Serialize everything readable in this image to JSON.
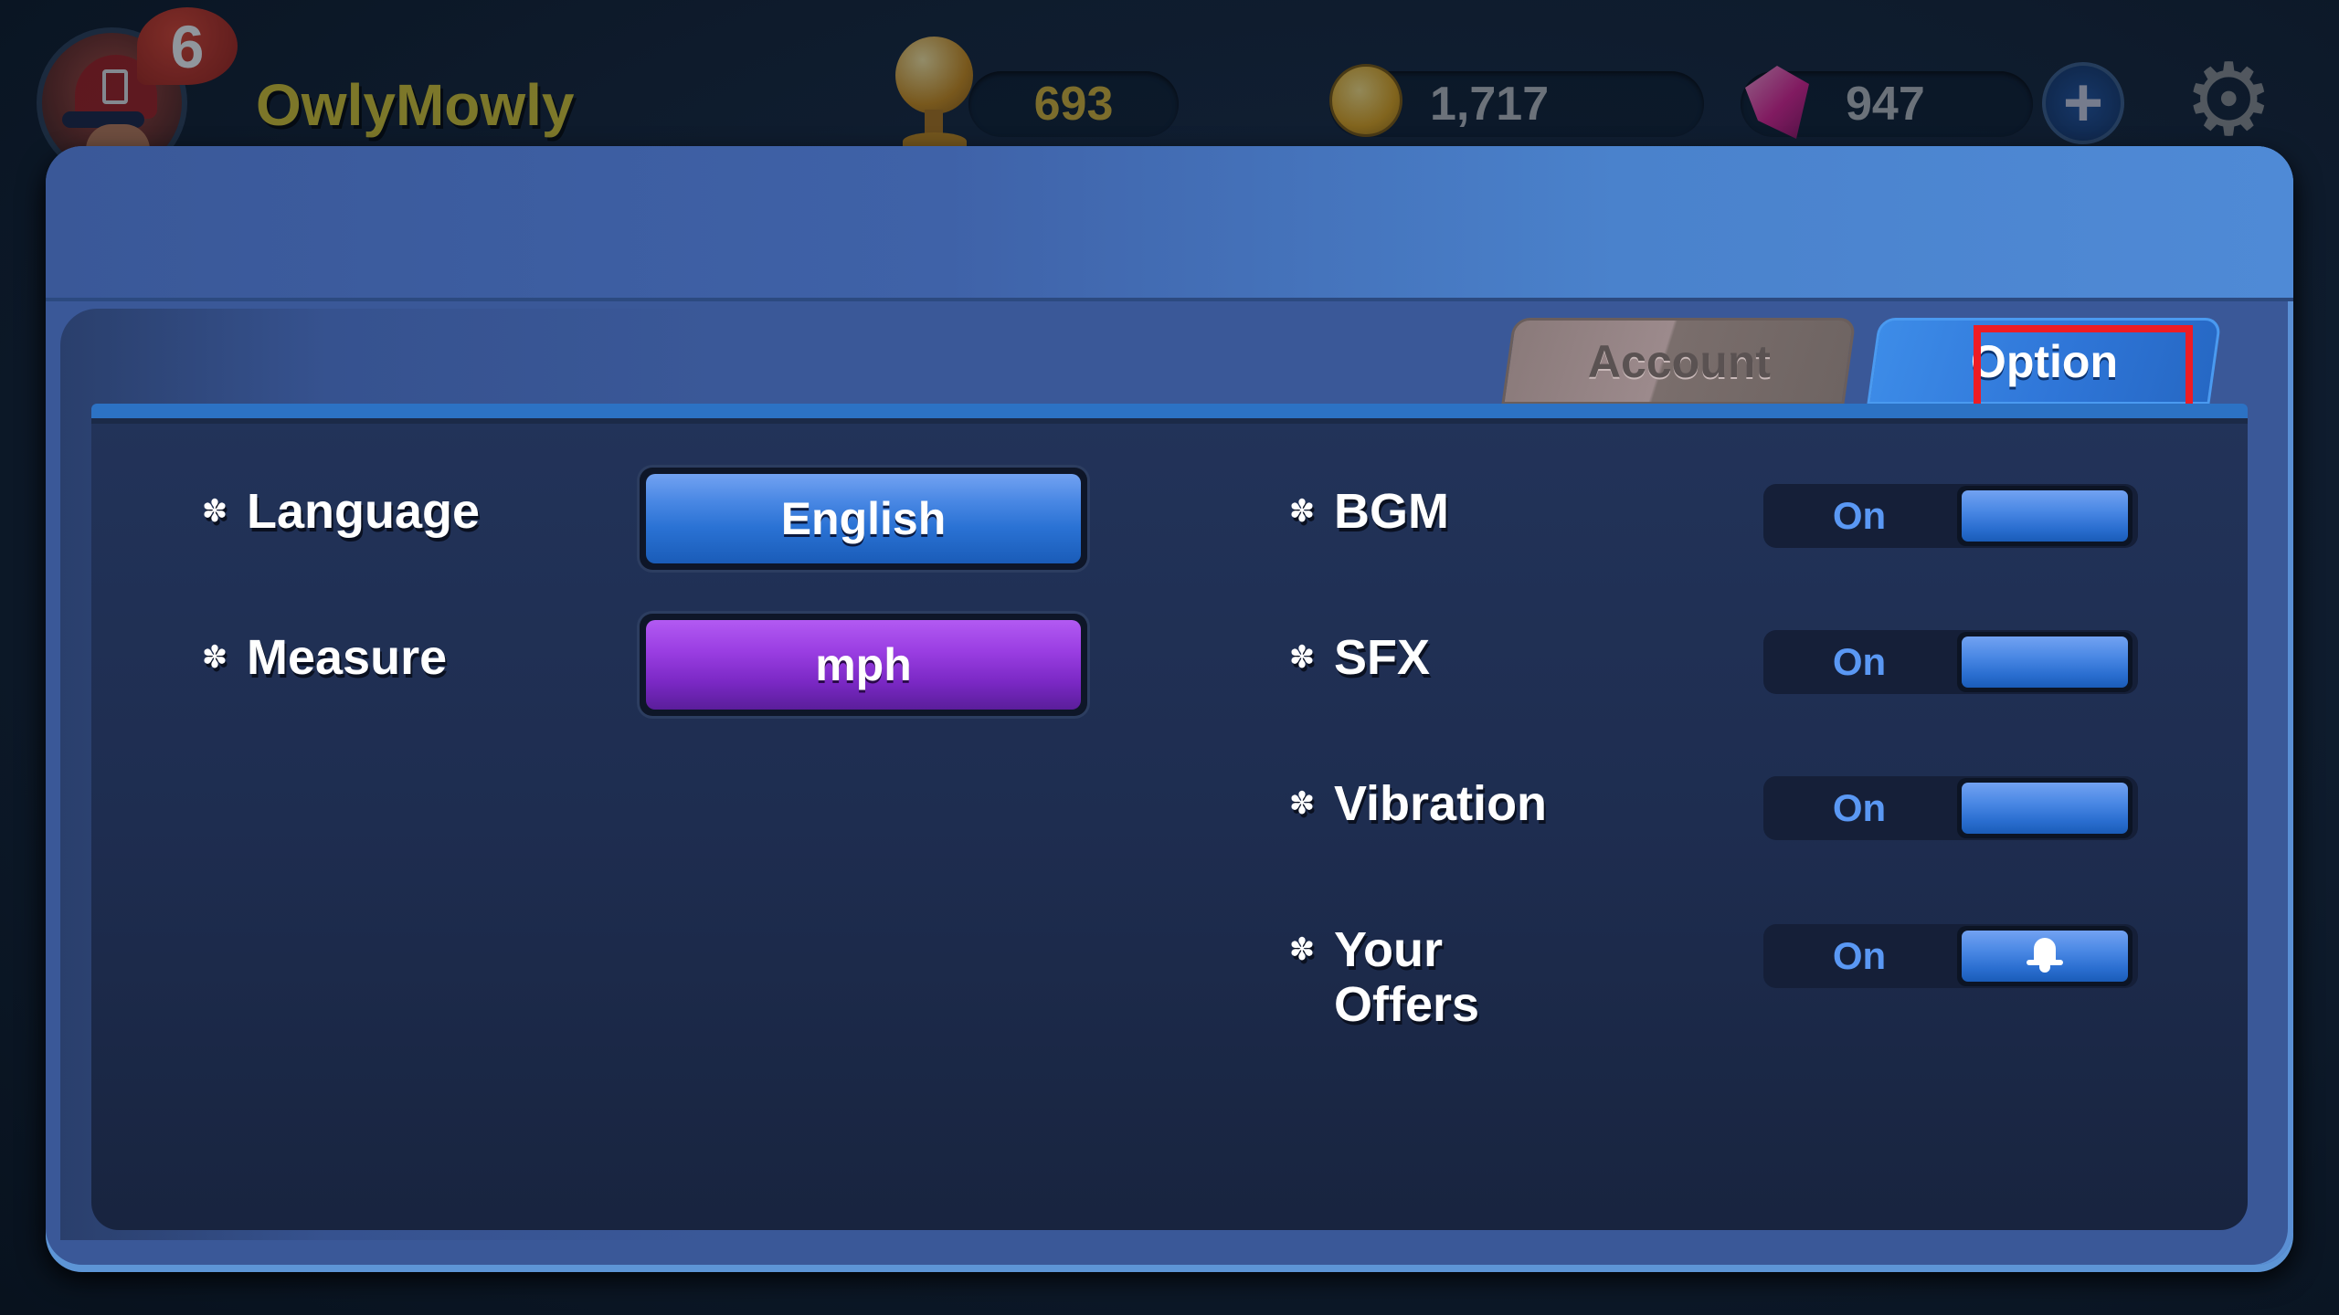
{
  "topbar": {
    "level": "6",
    "username": "OwlyMowly",
    "trophies": "693",
    "coins": "1,717",
    "gems": "947",
    "icons": {
      "avatar": "player-avatar",
      "trophy": "trophy-icon",
      "coin": "coin-icon",
      "gem": "gem-icon",
      "plus": "+",
      "settings": "⚙"
    }
  },
  "tabs": [
    {
      "label": "Account",
      "active": false
    },
    {
      "label": "Option",
      "active": true
    }
  ],
  "options_left": [
    {
      "label": "Language",
      "value": "English",
      "color": "#2a72d4"
    },
    {
      "label": "Measure",
      "value": "mph",
      "color": "#8a34d4"
    }
  ],
  "options_right": [
    {
      "label": "BGM",
      "state": "On"
    },
    {
      "label": "SFX",
      "state": "On"
    },
    {
      "label": "Vibration",
      "state": "On"
    },
    {
      "label_line1": "Your",
      "label_line2": "Offers",
      "state": "On",
      "icon": "bell-icon"
    }
  ],
  "bullet_glyph": "✽",
  "colors": {
    "accent_blue": "#2a72d4",
    "measure_purple": "#8a34d4",
    "toggle_on_text": "#5a98f4",
    "highlight_red": "#ee1c24",
    "username_gold": "#d9c52a"
  }
}
